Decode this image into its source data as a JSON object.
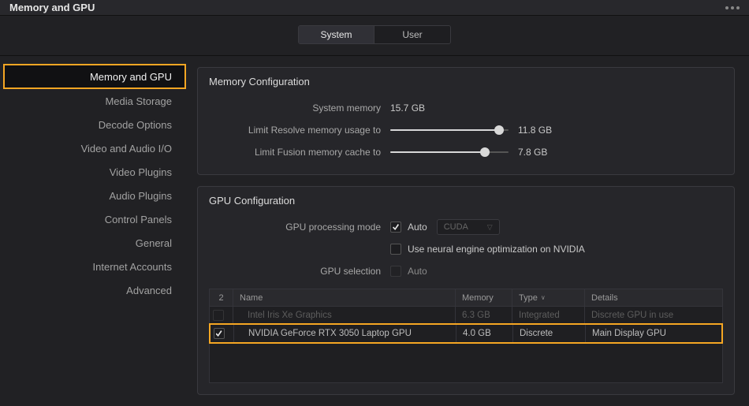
{
  "header": {
    "title": "Memory and GPU"
  },
  "tabs": {
    "system": "System",
    "user": "User"
  },
  "sidebar": {
    "items": [
      {
        "label": "Memory and GPU",
        "active": true
      },
      {
        "label": "Media Storage"
      },
      {
        "label": "Decode Options"
      },
      {
        "label": "Video and Audio I/O"
      },
      {
        "label": "Video Plugins"
      },
      {
        "label": "Audio Plugins"
      },
      {
        "label": "Control Panels"
      },
      {
        "label": "General"
      },
      {
        "label": "Internet Accounts"
      },
      {
        "label": "Advanced"
      }
    ]
  },
  "memory": {
    "section_title": "Memory Configuration",
    "sysmem_label": "System memory",
    "sysmem_value": "15.7 GB",
    "resolve_label": "Limit Resolve memory usage to",
    "resolve_value": "11.8 GB",
    "fusion_label": "Limit Fusion memory cache to",
    "fusion_value": "7.8 GB"
  },
  "gpu": {
    "section_title": "GPU Configuration",
    "mode_label": "GPU processing mode",
    "auto_label": "Auto",
    "api_select": "CUDA",
    "neural_label": "Use neural engine optimization on NVIDIA",
    "selection_label": "GPU selection",
    "table": {
      "count": "2",
      "h_name": "Name",
      "h_mem": "Memory",
      "h_type": "Type",
      "h_details": "Details",
      "rows": [
        {
          "name": "Intel Iris Xe Graphics",
          "mem": "6.3 GB",
          "type": "Integrated",
          "details": "Discrete GPU in use",
          "checked": false,
          "dim": true
        },
        {
          "name": "NVIDIA GeForce RTX 3050 Laptop GPU",
          "mem": "4.0 GB",
          "type": "Discrete",
          "details": "Main Display GPU",
          "checked": true,
          "dim": false
        }
      ]
    }
  }
}
